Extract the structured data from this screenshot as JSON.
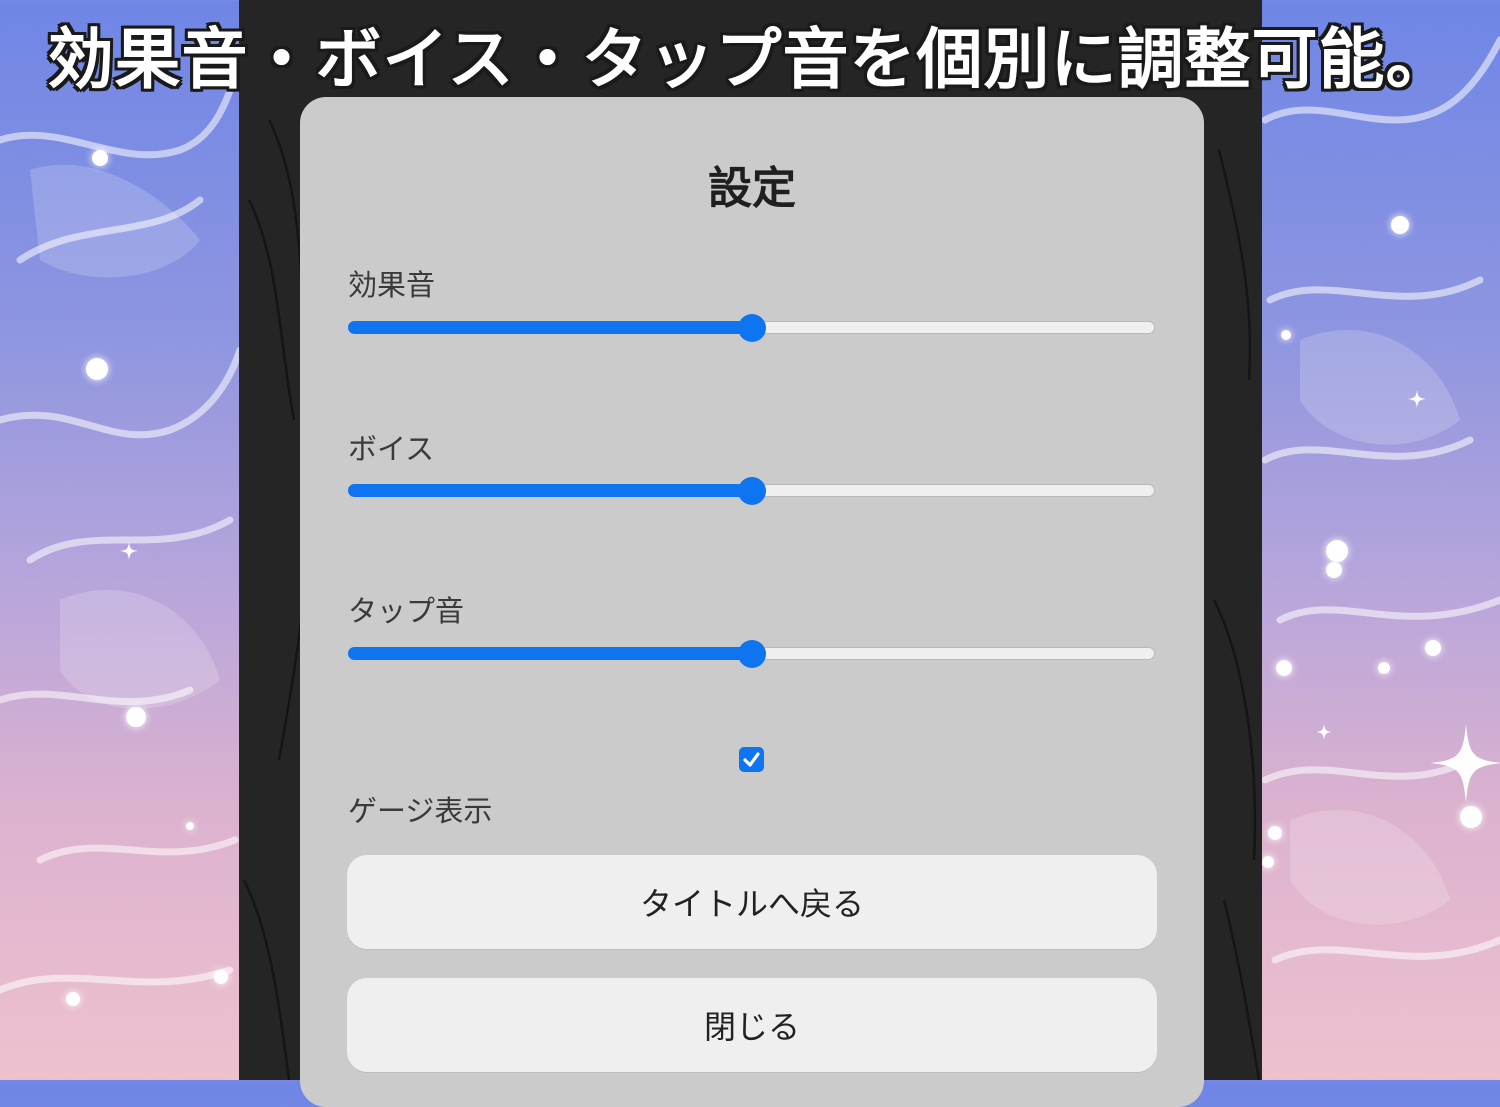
{
  "banner": {
    "text": "効果音・ボイス・タップ音を個別に調整可能。"
  },
  "settings": {
    "title": "設定",
    "sliders": [
      {
        "label": "効果音",
        "value": 0.5
      },
      {
        "label": "ボイス",
        "value": 0.5
      },
      {
        "label": "タップ音",
        "value": 0.5
      }
    ],
    "gauge": {
      "label": "ゲージ表示",
      "checked": true
    },
    "buttons": {
      "back_to_title": "タイトルへ戻る",
      "close": "閉じる"
    }
  },
  "colors": {
    "accent": "#0f74f0",
    "modal_bg": "#cbcbcb",
    "button_bg": "#efefef",
    "backdrop": "#252525"
  }
}
